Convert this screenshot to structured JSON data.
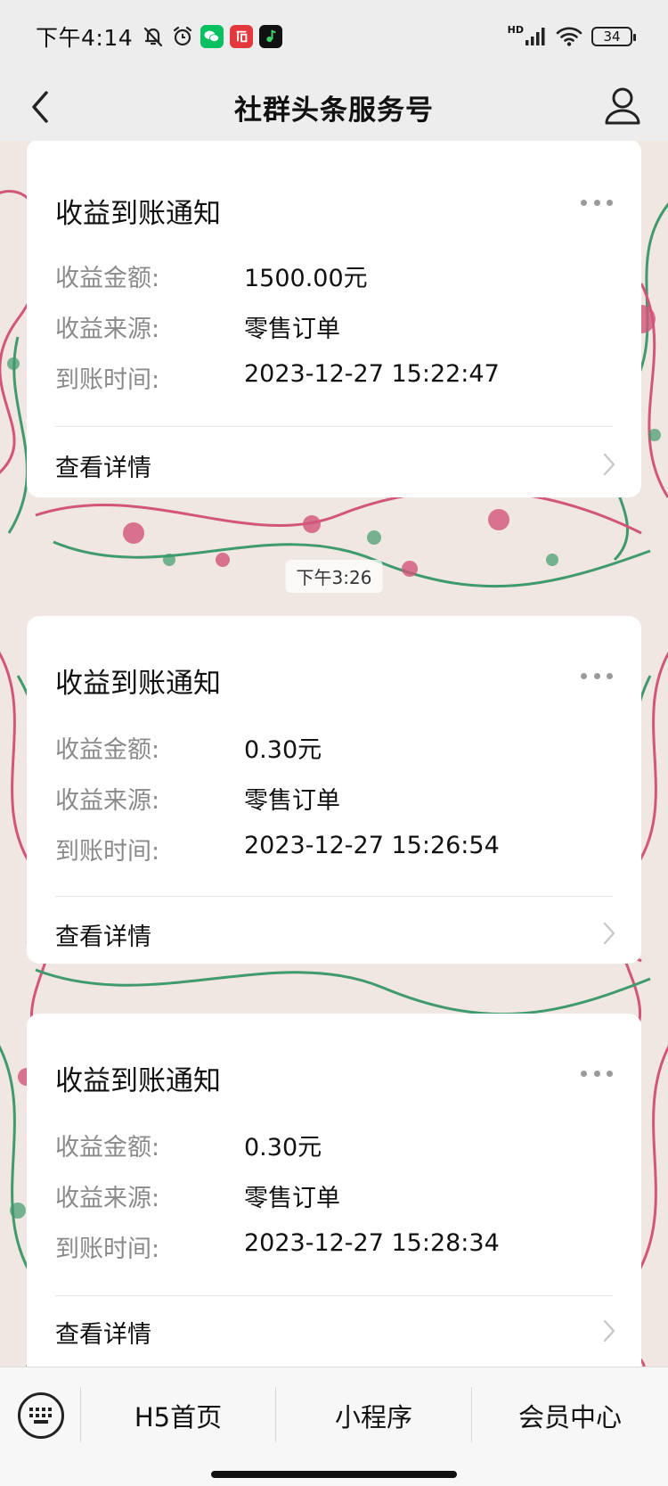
{
  "status_bar": {
    "time": "下午4:14",
    "battery": "34",
    "network_badge": "HD"
  },
  "nav": {
    "title": "社群头条服务号"
  },
  "timestamps": [
    "下午3:26"
  ],
  "labels": {
    "amount": "收益金额:",
    "source": "收益来源:",
    "time": "到账时间:"
  },
  "cards": [
    {
      "title": "收益到账通知",
      "amount": "1500.00元",
      "source": "零售订单",
      "time": "2023-12-27 15:22:47",
      "detail": "查看详情"
    },
    {
      "title": "收益到账通知",
      "amount": "0.30元",
      "source": "零售订单",
      "time": "2023-12-27 15:26:54",
      "detail": "查看详情"
    },
    {
      "title": "收益到账通知",
      "amount": "0.30元",
      "source": "零售订单",
      "time": "2023-12-27 15:28:34",
      "detail": "查看详情"
    }
  ],
  "menu": {
    "items": [
      "H5首页",
      "小程序",
      "会员中心"
    ]
  },
  "colors": {
    "background": "#ededed",
    "card": "#ffffff",
    "label_gray": "#8a8a8a",
    "pattern_red": "#d2557a",
    "pattern_green": "#3f9a6c"
  },
  "icons": {
    "status": [
      "bell-off-icon",
      "alarm-icon",
      "wechat-icon",
      "taobao-icon",
      "music-app-icon",
      "signal-icon",
      "wifi-icon",
      "battery-icon"
    ],
    "nav": [
      "back-arrow-icon",
      "user-icon"
    ],
    "bottom": [
      "keyboard-icon"
    ]
  }
}
